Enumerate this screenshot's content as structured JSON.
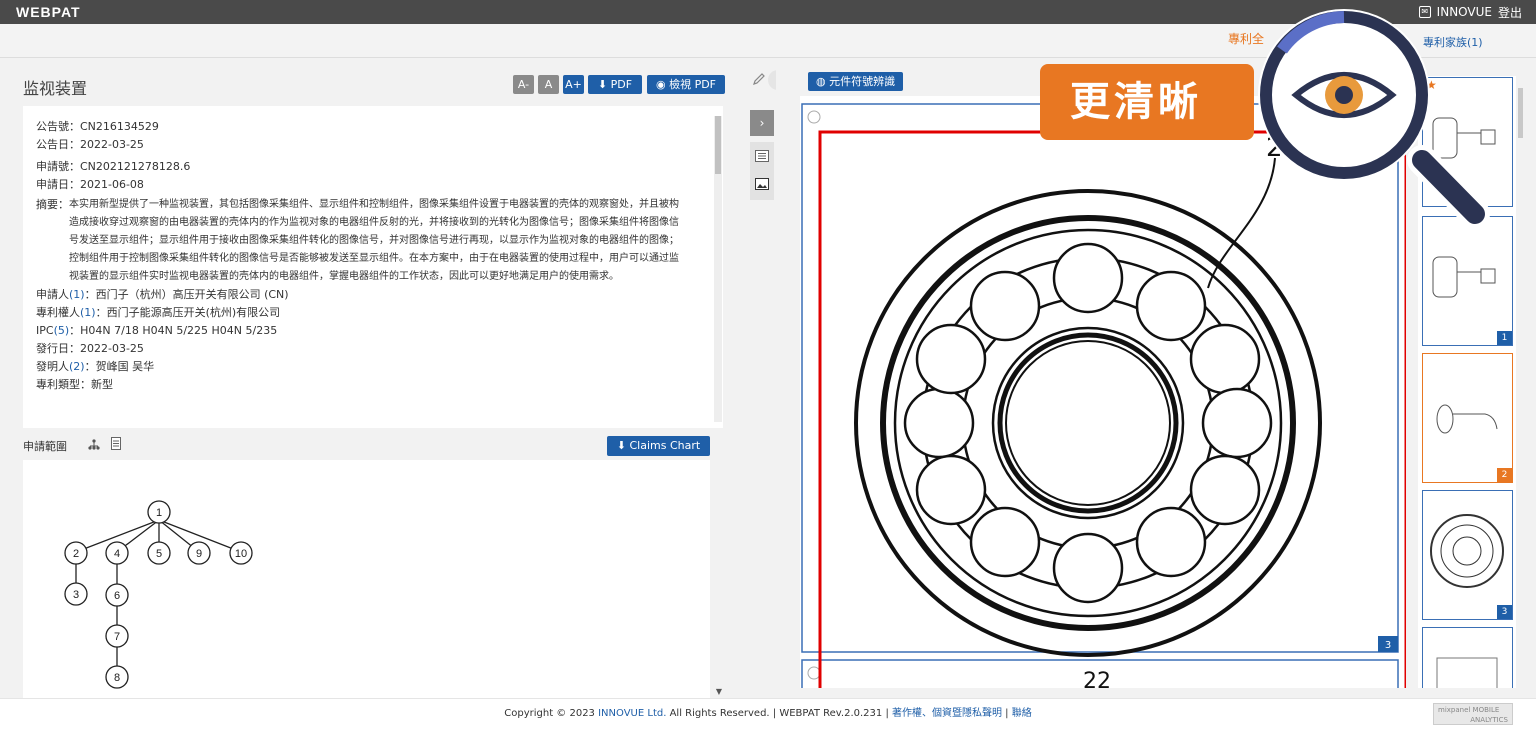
{
  "topbar": {
    "logo": "WEBPAT",
    "user_icon": "user-badge-icon",
    "user_name": "INNOVUE",
    "logout": "登出"
  },
  "subbar": {
    "tab_active_fragment": "專利全",
    "tab_family": "專利家族(1)"
  },
  "left": {
    "title": "监视装置",
    "font_small": "A-",
    "font_normal": "A",
    "font_large": "A+",
    "pdf_label": "PDF",
    "view_pdf_label": "檢視 PDF",
    "info": {
      "pub_no": "公告號：CN216134529",
      "pub_date": "公告日：2022-03-25",
      "app_no": "申請號：CN202121278128.6",
      "app_date": "申請日：2021-06-08",
      "abstract_label": "摘要：",
      "abstract": "本实用新型提供了一种监视装置，其包括图像采集组件、显示组件和控制组件，图像采集组件设置于电器装置的壳体的观察窗处，并且被构造成接收穿过观察窗的由电器装置的壳体内的作为监视对象的电器组件反射的光，并将接收到的光转化为图像信号；图像采集组件将图像信号发送至显示组件；显示组件用于接收由图像采集组件转化的图像信号，并对图像信号进行再现，以显示作为监视对象的电器组件的图像；控制组件用于控制图像采集组件转化的图像信号是否能够被发送至显示组件。在本方案中，由于在电器装置的使用过程中，用户可以通过监视装置的显示组件实时监视电器装置的壳体内的电器组件，掌握电器组件的工作状态，因此可以更好地满足用户的使用需求。",
      "applicant_label": "申請人",
      "applicant_count": "(1)",
      "applicant_value": "：西门子（杭州）高压开关有限公司 (CN)",
      "assignee_label": "專利權人",
      "assignee_count": "(1)",
      "assignee_value": "：西门子能源高压开关(杭州)有限公司",
      "ipc_label": "IPC",
      "ipc_count": "(5)",
      "ipc_value": "：H04N 7/18    H04N 5/225    H04N 5/235",
      "issue_date": "發行日：2022-03-25",
      "inventor_label": "發明人",
      "inventor_count": "(2)",
      "inventor_value": "：贺峰国    吴华",
      "patent_type": "專利類型：新型"
    },
    "claims_label": "申請範圍",
    "claims_tree_icon": "tree-icon",
    "claims_doc_icon": "document-icon",
    "claims_chart_btn": "Claims Chart",
    "claim_tree": {
      "root": "1",
      "children": [
        "2",
        "4",
        "5",
        "9",
        "10"
      ],
      "under_2": [
        "3"
      ],
      "under_4": [
        "6",
        "7",
        "8"
      ]
    }
  },
  "right": {
    "element_recognition_btn": "元件符號辨識",
    "main_figure_page": "3",
    "label_top": "2",
    "label_bottom": "22",
    "thumbnail_pages": [
      "",
      "1",
      "2",
      "3",
      ""
    ],
    "star_icon": "star-icon"
  },
  "callout": {
    "text": "更清晰",
    "icon": "magnifier-eye-icon"
  },
  "footer": {
    "copyright_pre": "Copyright © 2023 ",
    "company": "INNOVUE Ltd.",
    "copyright_post": " All Rights Reserved. | WEBPAT Rev.2.0.231 | ",
    "privacy": "著作權、個資暨隱私聲明",
    "sep": " | ",
    "contact": "聯絡",
    "mixpanel_line1": "mixpanel MOBILE",
    "mixpanel_line2": "ANALYTICS"
  },
  "colors": {
    "accent_blue": "#1f5fa8",
    "accent_orange": "#e87722",
    "highlight_red": "#e00000",
    "topbar": "#4a4a4a"
  }
}
